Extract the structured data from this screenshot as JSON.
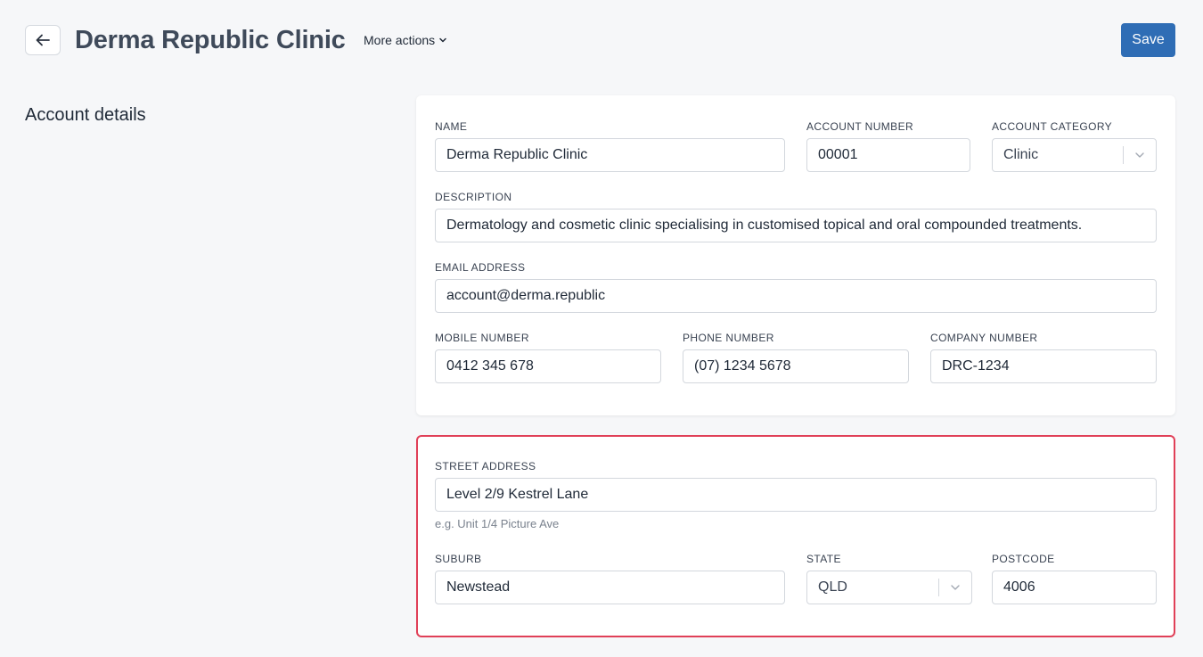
{
  "header": {
    "title": "Derma Republic Clinic",
    "more_actions": "More actions",
    "save_label": "Save"
  },
  "section": {
    "title": "Account details"
  },
  "account": {
    "name": {
      "label": "NAME",
      "value": "Derma Republic Clinic"
    },
    "account_number": {
      "label": "ACCOUNT NUMBER",
      "value": "00001"
    },
    "account_category": {
      "label": "ACCOUNT CATEGORY",
      "value": "Clinic"
    },
    "description": {
      "label": "DESCRIPTION",
      "value": "Dermatology and cosmetic clinic specialising in customised topical and oral compounded treatments."
    },
    "email": {
      "label": "EMAIL ADDRESS",
      "value": "account@derma.republic"
    },
    "mobile": {
      "label": "MOBILE NUMBER",
      "value": "0412 345 678"
    },
    "phone": {
      "label": "PHONE NUMBER",
      "value": "(07) 1234 5678"
    },
    "company_number": {
      "label": "COMPANY NUMBER",
      "value": "DRC-1234"
    }
  },
  "address": {
    "street": {
      "label": "STREET ADDRESS",
      "value": "Level 2/9 Kestrel Lane",
      "helper": "e.g. Unit 1/4 Picture Ave"
    },
    "suburb": {
      "label": "SUBURB",
      "value": "Newstead"
    },
    "state": {
      "label": "STATE",
      "value": "QLD"
    },
    "postcode": {
      "label": "POSTCODE",
      "value": "4006"
    }
  },
  "colors": {
    "accent": "#2f6db5",
    "highlight_border": "#e04058",
    "background": "#f6f7f9"
  },
  "icons": {
    "back": "arrow-left-icon",
    "more_actions": "chevron-down-icon",
    "select_caret": "chevron-down-icon"
  }
}
